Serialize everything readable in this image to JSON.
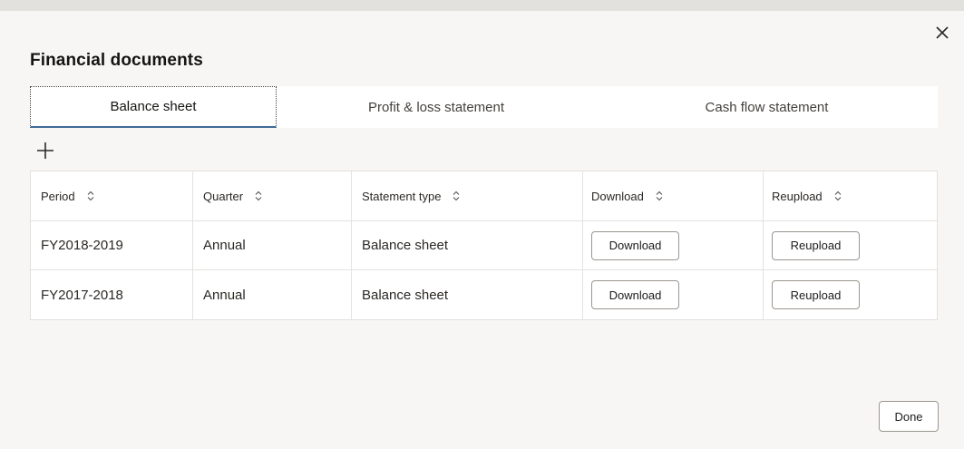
{
  "dialog": {
    "title": "Financial documents",
    "close_icon": "close-icon",
    "done_label": "Done"
  },
  "tabs": [
    {
      "label": "Balance sheet",
      "active": true
    },
    {
      "label": "Profit & loss statement",
      "active": false
    },
    {
      "label": "Cash flow statement",
      "active": false
    }
  ],
  "toolbar": {
    "add_icon": "plus-icon"
  },
  "table": {
    "columns": [
      "Period",
      "Quarter",
      "Statement type",
      "Download",
      "Reupload"
    ],
    "sort_icon": "sort-icon",
    "rows": [
      {
        "period": "FY2018-2019",
        "quarter": "Annual",
        "statement_type": "Balance sheet",
        "download_label": "Download",
        "reupload_label": "Reupload"
      },
      {
        "period": "FY2017-2018",
        "quarter": "Annual",
        "statement_type": "Balance sheet",
        "download_label": "Download",
        "reupload_label": "Reupload"
      }
    ]
  },
  "colors": {
    "active_tab_underline": "#3f6b96",
    "background": "#f7f6f5",
    "panel": "#ffffff"
  }
}
